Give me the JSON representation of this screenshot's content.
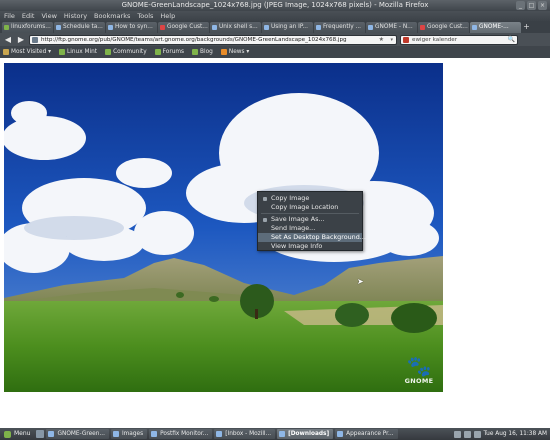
{
  "window": {
    "title": "GNOME-GreenLandscape_1024x768.jpg (JPEG Image, 1024x768 pixels) - Mozilla Firefox",
    "controls": [
      "_",
      "□",
      "×"
    ]
  },
  "menubar": {
    "items": [
      "File",
      "Edit",
      "View",
      "History",
      "Bookmarks",
      "Tools",
      "Help"
    ]
  },
  "tabs": [
    {
      "label": "linuxforums...",
      "icon": "linux-icon"
    },
    {
      "label": "Schedule ta...",
      "icon": "page-icon"
    },
    {
      "label": "How to syn...",
      "icon": "page-icon"
    },
    {
      "label": "Google Cust...",
      "icon": "google-icon"
    },
    {
      "label": "Unix shell s...",
      "icon": "page-icon"
    },
    {
      "label": "Using an IP...",
      "icon": "page-icon"
    },
    {
      "label": "Frequently ...",
      "icon": "page-icon"
    },
    {
      "label": "GNOME - N...",
      "icon": "gnome-icon"
    },
    {
      "label": "Google Cust...",
      "icon": "google-icon"
    },
    {
      "label": "GNOME-...",
      "icon": "image-icon"
    }
  ],
  "tab_new": "+",
  "navbar": {
    "back": "◀",
    "forward": "▶",
    "url": "http://ftp.gnome.org/pub/GNOME/teams/art.gnome.org/backgrounds/GNOME-GreenLandscape_1024x768.jpg",
    "star": "★",
    "dropdown": "▾",
    "search_placeholder": "ewiger kalender",
    "search_icon": "🔍"
  },
  "bookmarks": [
    {
      "label": "Most Visited ▾",
      "icon": "folder-icon"
    },
    {
      "label": "Linux Mint",
      "icon": "mint-icon"
    },
    {
      "label": "Community",
      "icon": "mint-icon"
    },
    {
      "label": "Forums",
      "icon": "mint-icon"
    },
    {
      "label": "Blog",
      "icon": "mint-icon"
    },
    {
      "label": "News ▾",
      "icon": "rss-icon"
    }
  ],
  "image": {
    "logo_text": "GNOME",
    "logo_glyph": "🐾"
  },
  "context_menu": {
    "items": [
      {
        "label": "Copy Image",
        "hover": false
      },
      {
        "label": "Copy Image Location",
        "hover": false
      },
      {
        "separator": true
      },
      {
        "label": "Save Image As...",
        "hover": false
      },
      {
        "label": "Send Image...",
        "hover": false
      },
      {
        "label": "Set As Desktop Background...",
        "hover": true
      },
      {
        "label": "View Image Info",
        "hover": false
      }
    ]
  },
  "taskbar": {
    "menu_label": "Menu",
    "tasks": [
      {
        "label": "GNOME-Green...",
        "active": false
      },
      {
        "label": "Images",
        "active": false
      },
      {
        "label": "Postfix Monitor...",
        "active": false
      },
      {
        "label": "[Inbox - Mozill...",
        "active": false
      },
      {
        "label": "[Downloads]",
        "active": true
      },
      {
        "label": "Appearance Pr...",
        "active": false
      }
    ],
    "clock": "Tue Aug 16, 11:38 AM"
  }
}
